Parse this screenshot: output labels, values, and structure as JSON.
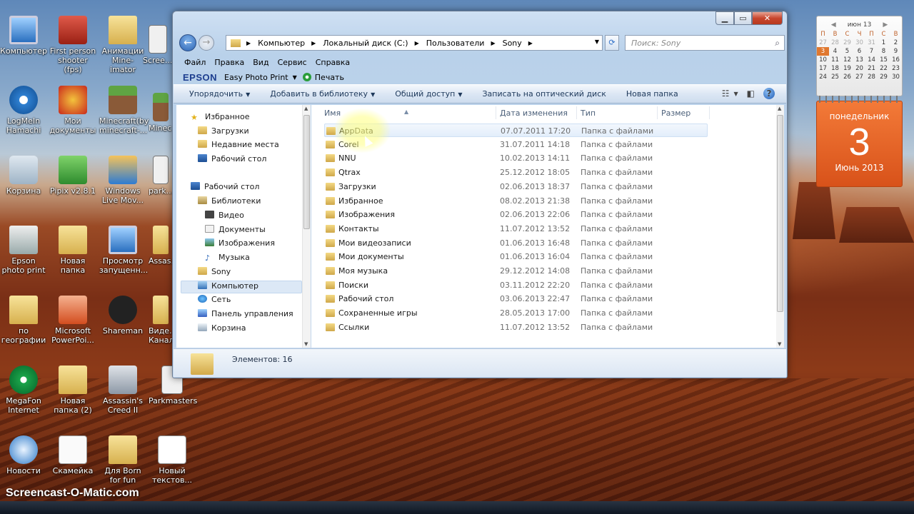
{
  "desktop": {
    "icons": [
      {
        "label": "Компьютер"
      },
      {
        "label": "First person shooter (fps)"
      },
      {
        "label": "Анимации Mine-imator"
      },
      {
        "label": "Scree..."
      },
      {
        "label": "LogMeIn Hamachi"
      },
      {
        "label": "Мои документы"
      },
      {
        "label": "Minecraft(by minecraft-..."
      },
      {
        "label": "Minec..."
      },
      {
        "label": "Корзина"
      },
      {
        "label": "Pipix v2.8.1"
      },
      {
        "label": "Windows Live Mov..."
      },
      {
        "label": "park..."
      },
      {
        "label": "Epson photo print"
      },
      {
        "label": "Новая папка"
      },
      {
        "label": "Просмотр запущенн..."
      },
      {
        "label": "Assas..."
      },
      {
        "label": "по географии"
      },
      {
        "label": "Microsoft PowerPoi..."
      },
      {
        "label": "Shareman"
      },
      {
        "label": "Виде... Канал..."
      },
      {
        "label": "MegaFon Internet"
      },
      {
        "label": "Новая папка (2)"
      },
      {
        "label": "Assassin's Creed II"
      },
      {
        "label": "Parkmasters"
      },
      {
        "label": "Новости"
      },
      {
        "label": "Скамейка"
      },
      {
        "label": "Для Born for fun"
      },
      {
        "label": "Новый текстов..."
      }
    ]
  },
  "calendar": {
    "month_header": "июн 13",
    "weekdays": [
      "П",
      "В",
      "С",
      "Ч",
      "П",
      "С",
      "В"
    ],
    "weeks": [
      [
        "27",
        "28",
        "29",
        "30",
        "31",
        "1",
        "2"
      ],
      [
        "3",
        "4",
        "5",
        "6",
        "7",
        "8",
        "9"
      ],
      [
        "10",
        "11",
        "12",
        "13",
        "14",
        "15",
        "16"
      ],
      [
        "17",
        "18",
        "19",
        "20",
        "21",
        "22",
        "23"
      ],
      [
        "24",
        "25",
        "26",
        "27",
        "28",
        "29",
        "30"
      ]
    ],
    "day_name": "понедельник",
    "day": "3",
    "month_year": "Июнь 2013"
  },
  "window": {
    "address": {
      "crumbs": [
        "Компьютер",
        "Локальный диск (C:)",
        "Пользователи",
        "Sony"
      ]
    },
    "search_placeholder": "Поиск: Sony",
    "menu": [
      "Файл",
      "Правка",
      "Вид",
      "Сервис",
      "Справка"
    ],
    "epson": {
      "brand": "EPSON",
      "app": "Easy Photo Print",
      "print": "Печать"
    },
    "commands": [
      {
        "label": "Упорядочить",
        "dropdown": true
      },
      {
        "label": "Добавить в библиотеку",
        "dropdown": true
      },
      {
        "label": "Общий доступ",
        "dropdown": true
      },
      {
        "label": "Записать на оптический диск",
        "dropdown": false
      },
      {
        "label": "Новая папка",
        "dropdown": false
      }
    ],
    "nav": {
      "favorites": "Избранное",
      "downloads": "Загрузки",
      "recent": "Недавние места",
      "desktop_fav": "Рабочий стол",
      "desktop": "Рабочий стол",
      "libraries": "Библиотеки",
      "video": "Видео",
      "documents": "Документы",
      "pictures": "Изображения",
      "music": "Музыка",
      "sony": "Sony",
      "computer": "Компьютер",
      "network": "Сеть",
      "control_panel": "Панель управления",
      "recycle": "Корзина"
    },
    "columns": {
      "name": "Имя",
      "date": "Дата изменения",
      "type": "Тип",
      "size": "Размер"
    },
    "files": [
      {
        "name": "AppData",
        "date": "07.07.2011 17:20",
        "type": "Папка с файлами"
      },
      {
        "name": "Corel",
        "date": "31.07.2011 14:18",
        "type": "Папка с файлами"
      },
      {
        "name": "NNU",
        "date": "10.02.2013 14:11",
        "type": "Папка с файлами"
      },
      {
        "name": "Qtrax",
        "date": "25.12.2012 18:05",
        "type": "Папка с файлами"
      },
      {
        "name": "Загрузки",
        "date": "02.06.2013 18:37",
        "type": "Папка с файлами"
      },
      {
        "name": "Избранное",
        "date": "08.02.2013 21:38",
        "type": "Папка с файлами"
      },
      {
        "name": "Изображения",
        "date": "02.06.2013 22:06",
        "type": "Папка с файлами"
      },
      {
        "name": "Контакты",
        "date": "11.07.2012 13:52",
        "type": "Папка с файлами"
      },
      {
        "name": "Мои видеозаписи",
        "date": "01.06.2013 16:48",
        "type": "Папка с файлами"
      },
      {
        "name": "Мои документы",
        "date": "01.06.2013 16:04",
        "type": "Папка с файлами"
      },
      {
        "name": "Моя музыка",
        "date": "29.12.2012 14:08",
        "type": "Папка с файлами"
      },
      {
        "name": "Поиски",
        "date": "03.11.2012 22:20",
        "type": "Папка с файлами"
      },
      {
        "name": "Рабочий стол",
        "date": "03.06.2013 22:47",
        "type": "Папка с файлами"
      },
      {
        "name": "Сохраненные игры",
        "date": "28.05.2013 17:00",
        "type": "Папка с файлами"
      },
      {
        "name": "Ссылки",
        "date": "11.07.2012 13:52",
        "type": "Папка с файлами"
      }
    ],
    "status": "Элементов: 16"
  },
  "watermark": "Screencast-O-Matic.com"
}
